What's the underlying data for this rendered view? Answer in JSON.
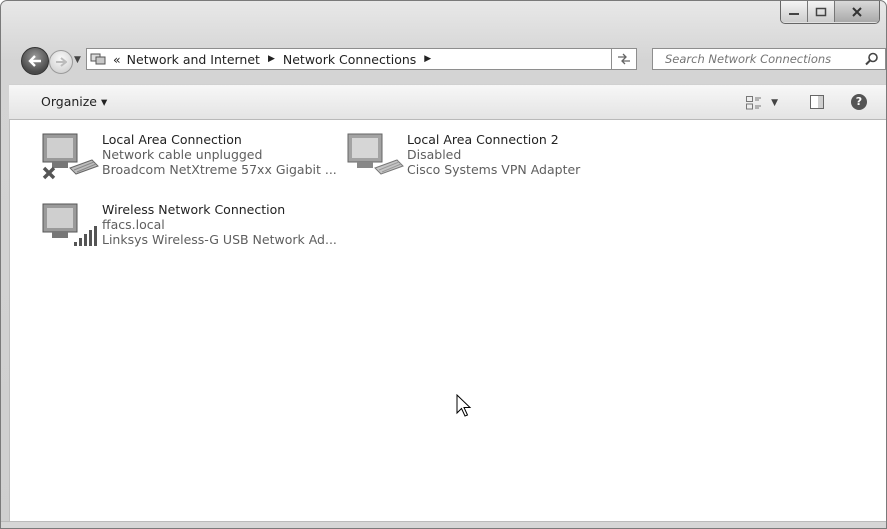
{
  "window": {
    "caption_buttons": [
      "minimize-icon",
      "maximize-icon",
      "close-icon"
    ]
  },
  "navigation": {
    "address_path": [
      "Network and Internet",
      "Network Connections"
    ],
    "overflow_glyph": "«",
    "search_placeholder": "Search Network Connections"
  },
  "toolbar": {
    "organize_label": "Organize ▾",
    "help_glyph": "?"
  },
  "connections": [
    {
      "name": "Local Area Connection",
      "status": "Network cable unplugged",
      "adapter": "Broadcom NetXtreme 57xx Gigabit ...",
      "overlay": "red-x"
    },
    {
      "name": "Local Area Connection 2",
      "status": "Disabled",
      "adapter": "Cisco Systems VPN Adapter",
      "overlay": "none"
    },
    {
      "name": "Wireless Network Connection",
      "status": "ffacs.local",
      "adapter": "Linksys Wireless-G USB Network Ad...",
      "overlay": "signal-bars"
    }
  ]
}
